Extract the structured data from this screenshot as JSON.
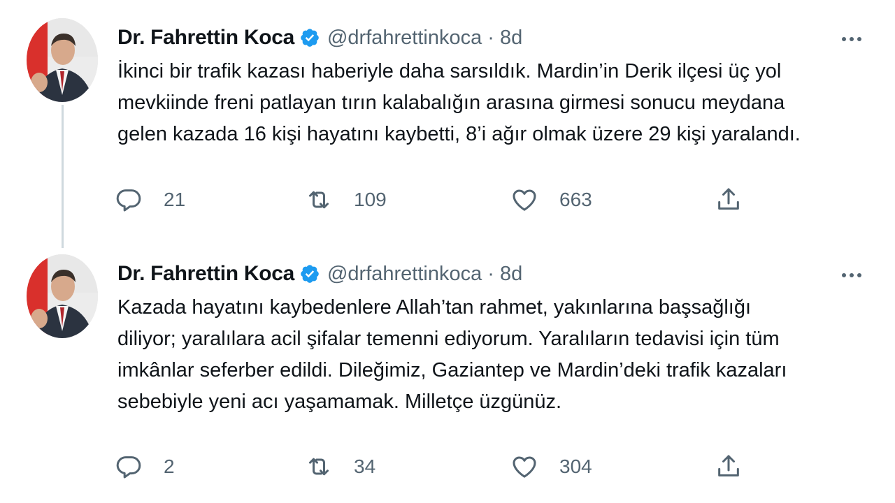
{
  "tweets": [
    {
      "author": {
        "name": "Dr. Fahrettin Koca",
        "handle": "@drfahrettinkoca",
        "verified": true,
        "avatar_icon": "profile-photo-man-suit-red-tie"
      },
      "separator": "·",
      "time": "8d",
      "text": "İkinci bir trafik kazası haberiyle daha sarsıldık. Mardin’in Derik ilçesi üç yol\nmevkiinde freni patlayan tırın kalabalığın arasına girmesi sonucu meydana\ngelen kazada 16 kişi hayatını kaybetti, 8’i ağır olmak üzere 29 kişi yaralandı.",
      "stats": {
        "replies": "21",
        "retweets": "109",
        "likes": "663"
      }
    },
    {
      "author": {
        "name": "Dr. Fahrettin Koca",
        "handle": "@drfahrettinkoca",
        "verified": true,
        "avatar_icon": "profile-photo-man-suit-red-tie"
      },
      "separator": "·",
      "time": "8d",
      "text": "Kazada hayatını kaybedenlere Allah’tan rahmet, yakınlarına başsağlığı\ndiliyor; yaralılara acil şifalar temenni ediyorum. Yaralıların tedavisi için tüm\nimkânlar seferber edildi. Dileğimiz, Gaziantep ve Mardin’deki trafik kazaları\nsebebiyle yeni acı yaşamamak. Milletçe üzgünüz.",
      "stats": {
        "replies": "2",
        "retweets": "34",
        "likes": "304"
      }
    }
  ],
  "icons": {
    "verified": "verified-badge-icon",
    "more": "more-dots-icon",
    "reply": "reply-bubble-icon",
    "retweet": "retweet-icon",
    "like": "heart-icon",
    "share": "share-upload-icon"
  },
  "colors": {
    "verified_blue": "#1d9bf0",
    "secondary_text": "#536471",
    "primary_text": "#0f1419",
    "thread_line": "#cfd9de"
  }
}
